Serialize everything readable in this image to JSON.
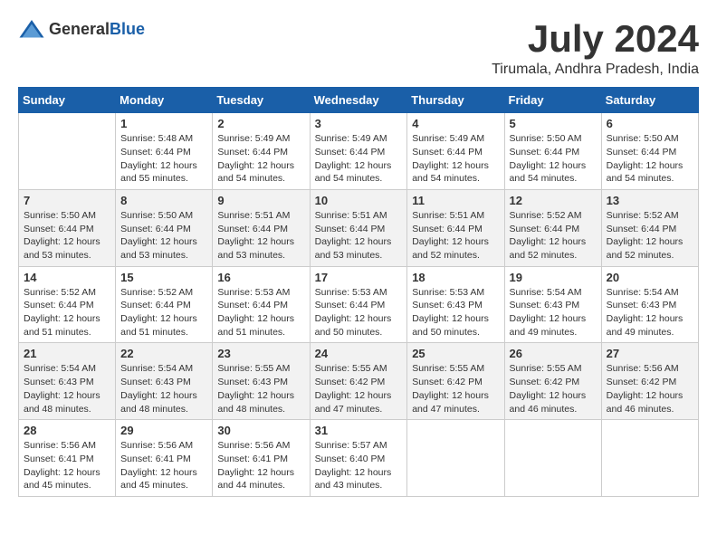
{
  "logo": {
    "general": "General",
    "blue": "Blue"
  },
  "title": "July 2024",
  "subtitle": "Tirumala, Andhra Pradesh, India",
  "days_of_week": [
    "Sunday",
    "Monday",
    "Tuesday",
    "Wednesday",
    "Thursday",
    "Friday",
    "Saturday"
  ],
  "weeks": [
    [
      {
        "day": "",
        "sunrise": "",
        "sunset": "",
        "daylight": ""
      },
      {
        "day": "1",
        "sunrise": "Sunrise: 5:48 AM",
        "sunset": "Sunset: 6:44 PM",
        "daylight": "Daylight: 12 hours and 55 minutes."
      },
      {
        "day": "2",
        "sunrise": "Sunrise: 5:49 AM",
        "sunset": "Sunset: 6:44 PM",
        "daylight": "Daylight: 12 hours and 54 minutes."
      },
      {
        "day": "3",
        "sunrise": "Sunrise: 5:49 AM",
        "sunset": "Sunset: 6:44 PM",
        "daylight": "Daylight: 12 hours and 54 minutes."
      },
      {
        "day": "4",
        "sunrise": "Sunrise: 5:49 AM",
        "sunset": "Sunset: 6:44 PM",
        "daylight": "Daylight: 12 hours and 54 minutes."
      },
      {
        "day": "5",
        "sunrise": "Sunrise: 5:50 AM",
        "sunset": "Sunset: 6:44 PM",
        "daylight": "Daylight: 12 hours and 54 minutes."
      },
      {
        "day": "6",
        "sunrise": "Sunrise: 5:50 AM",
        "sunset": "Sunset: 6:44 PM",
        "daylight": "Daylight: 12 hours and 54 minutes."
      }
    ],
    [
      {
        "day": "7",
        "sunrise": "Sunrise: 5:50 AM",
        "sunset": "Sunset: 6:44 PM",
        "daylight": "Daylight: 12 hours and 53 minutes."
      },
      {
        "day": "8",
        "sunrise": "Sunrise: 5:50 AM",
        "sunset": "Sunset: 6:44 PM",
        "daylight": "Daylight: 12 hours and 53 minutes."
      },
      {
        "day": "9",
        "sunrise": "Sunrise: 5:51 AM",
        "sunset": "Sunset: 6:44 PM",
        "daylight": "Daylight: 12 hours and 53 minutes."
      },
      {
        "day": "10",
        "sunrise": "Sunrise: 5:51 AM",
        "sunset": "Sunset: 6:44 PM",
        "daylight": "Daylight: 12 hours and 53 minutes."
      },
      {
        "day": "11",
        "sunrise": "Sunrise: 5:51 AM",
        "sunset": "Sunset: 6:44 PM",
        "daylight": "Daylight: 12 hours and 52 minutes."
      },
      {
        "day": "12",
        "sunrise": "Sunrise: 5:52 AM",
        "sunset": "Sunset: 6:44 PM",
        "daylight": "Daylight: 12 hours and 52 minutes."
      },
      {
        "day": "13",
        "sunrise": "Sunrise: 5:52 AM",
        "sunset": "Sunset: 6:44 PM",
        "daylight": "Daylight: 12 hours and 52 minutes."
      }
    ],
    [
      {
        "day": "14",
        "sunrise": "Sunrise: 5:52 AM",
        "sunset": "Sunset: 6:44 PM",
        "daylight": "Daylight: 12 hours and 51 minutes."
      },
      {
        "day": "15",
        "sunrise": "Sunrise: 5:52 AM",
        "sunset": "Sunset: 6:44 PM",
        "daylight": "Daylight: 12 hours and 51 minutes."
      },
      {
        "day": "16",
        "sunrise": "Sunrise: 5:53 AM",
        "sunset": "Sunset: 6:44 PM",
        "daylight": "Daylight: 12 hours and 51 minutes."
      },
      {
        "day": "17",
        "sunrise": "Sunrise: 5:53 AM",
        "sunset": "Sunset: 6:44 PM",
        "daylight": "Daylight: 12 hours and 50 minutes."
      },
      {
        "day": "18",
        "sunrise": "Sunrise: 5:53 AM",
        "sunset": "Sunset: 6:43 PM",
        "daylight": "Daylight: 12 hours and 50 minutes."
      },
      {
        "day": "19",
        "sunrise": "Sunrise: 5:54 AM",
        "sunset": "Sunset: 6:43 PM",
        "daylight": "Daylight: 12 hours and 49 minutes."
      },
      {
        "day": "20",
        "sunrise": "Sunrise: 5:54 AM",
        "sunset": "Sunset: 6:43 PM",
        "daylight": "Daylight: 12 hours and 49 minutes."
      }
    ],
    [
      {
        "day": "21",
        "sunrise": "Sunrise: 5:54 AM",
        "sunset": "Sunset: 6:43 PM",
        "daylight": "Daylight: 12 hours and 48 minutes."
      },
      {
        "day": "22",
        "sunrise": "Sunrise: 5:54 AM",
        "sunset": "Sunset: 6:43 PM",
        "daylight": "Daylight: 12 hours and 48 minutes."
      },
      {
        "day": "23",
        "sunrise": "Sunrise: 5:55 AM",
        "sunset": "Sunset: 6:43 PM",
        "daylight": "Daylight: 12 hours and 48 minutes."
      },
      {
        "day": "24",
        "sunrise": "Sunrise: 5:55 AM",
        "sunset": "Sunset: 6:42 PM",
        "daylight": "Daylight: 12 hours and 47 minutes."
      },
      {
        "day": "25",
        "sunrise": "Sunrise: 5:55 AM",
        "sunset": "Sunset: 6:42 PM",
        "daylight": "Daylight: 12 hours and 47 minutes."
      },
      {
        "day": "26",
        "sunrise": "Sunrise: 5:55 AM",
        "sunset": "Sunset: 6:42 PM",
        "daylight": "Daylight: 12 hours and 46 minutes."
      },
      {
        "day": "27",
        "sunrise": "Sunrise: 5:56 AM",
        "sunset": "Sunset: 6:42 PM",
        "daylight": "Daylight: 12 hours and 46 minutes."
      }
    ],
    [
      {
        "day": "28",
        "sunrise": "Sunrise: 5:56 AM",
        "sunset": "Sunset: 6:41 PM",
        "daylight": "Daylight: 12 hours and 45 minutes."
      },
      {
        "day": "29",
        "sunrise": "Sunrise: 5:56 AM",
        "sunset": "Sunset: 6:41 PM",
        "daylight": "Daylight: 12 hours and 45 minutes."
      },
      {
        "day": "30",
        "sunrise": "Sunrise: 5:56 AM",
        "sunset": "Sunset: 6:41 PM",
        "daylight": "Daylight: 12 hours and 44 minutes."
      },
      {
        "day": "31",
        "sunrise": "Sunrise: 5:57 AM",
        "sunset": "Sunset: 6:40 PM",
        "daylight": "Daylight: 12 hours and 43 minutes."
      },
      {
        "day": "",
        "sunrise": "",
        "sunset": "",
        "daylight": ""
      },
      {
        "day": "",
        "sunrise": "",
        "sunset": "",
        "daylight": ""
      },
      {
        "day": "",
        "sunrise": "",
        "sunset": "",
        "daylight": ""
      }
    ]
  ]
}
